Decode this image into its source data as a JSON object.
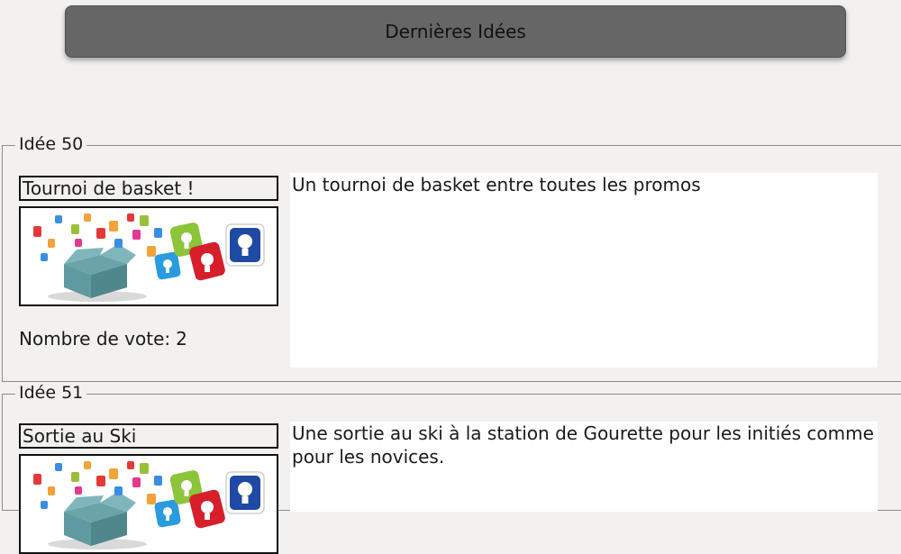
{
  "header": {
    "title": "Dernières Idées"
  },
  "colors": {
    "page_background": "#f2f1ef",
    "header_background": "#666666",
    "description_background": "#ffffff",
    "fieldset_border": "#8c8c8c"
  },
  "ideas": [
    {
      "legend": "Idée 50",
      "title": "Tournoi de basket !",
      "image_icon": "ideas-box-lightbulbs-illustration",
      "votes_label": "Nombre de vote:",
      "votes": "2",
      "description": "Un tournoi de basket entre toutes les promos"
    },
    {
      "legend": "Idée 51",
      "title": "Sortie au Ski",
      "image_icon": "ideas-box-lightbulbs-illustration",
      "description": "Une sortie au ski à la station de Gourette pour les initiés comme pour les novices."
    }
  ]
}
